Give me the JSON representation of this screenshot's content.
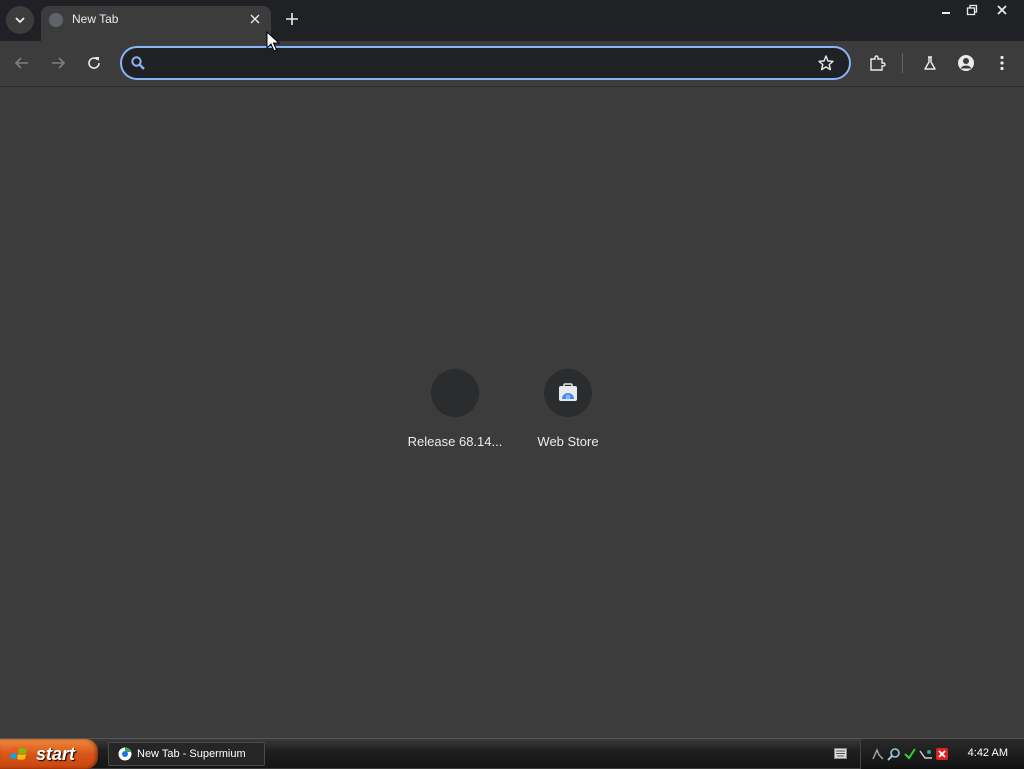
{
  "tabstrip": {
    "tabs": [
      {
        "title": "New Tab"
      }
    ]
  },
  "toolbar": {
    "omnibox": {
      "value": "",
      "placeholder": ""
    }
  },
  "shortcuts": [
    {
      "label": "Release 68.14...",
      "icon": "release-icon"
    },
    {
      "label": "Web Store",
      "icon": "web-store-icon"
    }
  ],
  "taskbar": {
    "start_label": "start",
    "task_items": [
      {
        "label": "New Tab - Supermium",
        "icon": "supermium-icon"
      }
    ],
    "clock": "4:42 AM"
  },
  "colors": {
    "accent": "#8ab4f8",
    "background": "#3c3c3c",
    "tabstrip": "#202124"
  }
}
